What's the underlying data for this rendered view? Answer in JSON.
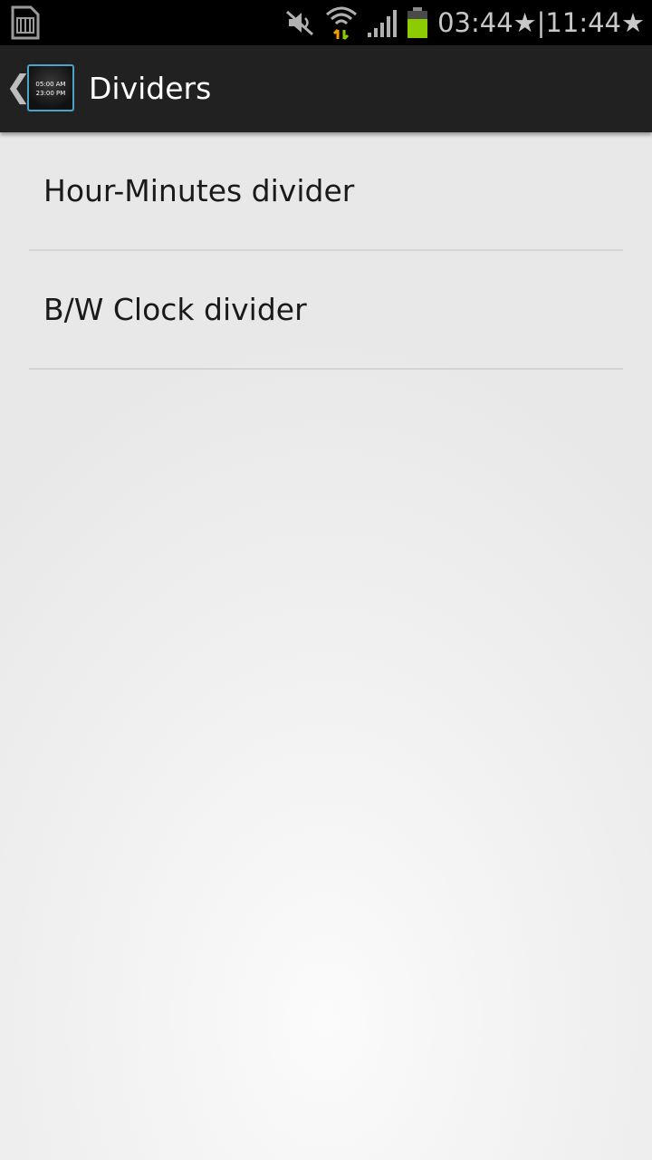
{
  "status_bar": {
    "time": "03:44★|11:44★",
    "icons": [
      "sd-card-icon",
      "mute-icon",
      "wifi-icon",
      "signal-icon",
      "battery-icon"
    ],
    "battery_color": "#8ccc00",
    "data_arrows_colors": [
      "#f5a000",
      "#8ccc00"
    ]
  },
  "action_bar": {
    "app_icon_line1": "05:00 AM",
    "app_icon_line2": "23:00 PM",
    "title": "Dividers",
    "accent": "#4aa3c8"
  },
  "list": {
    "items": [
      {
        "label": "Hour-Minutes divider"
      },
      {
        "label": "B/W Clock divider"
      }
    ]
  }
}
